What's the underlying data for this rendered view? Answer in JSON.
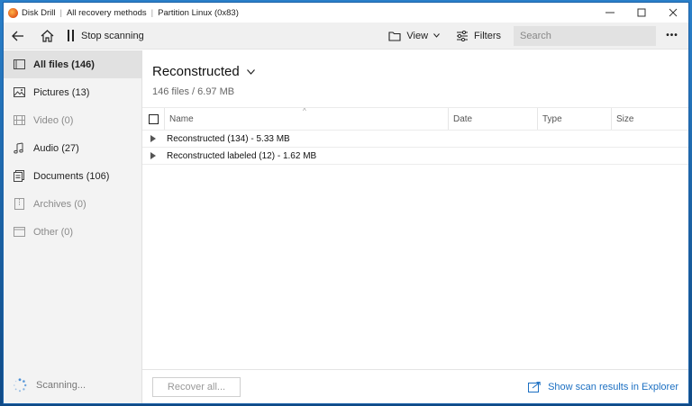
{
  "window": {
    "title_parts": [
      "Disk Drill",
      "All recovery methods",
      "Partition Linux (0x83)"
    ],
    "minimize": "—",
    "maximize": "☐",
    "close": "✕"
  },
  "toolbar": {
    "stop_label": "Stop scanning",
    "view_label": "View",
    "filters_label": "Filters",
    "search_placeholder": "Search",
    "more_label": "•••"
  },
  "sidebar": {
    "items": [
      {
        "label": "All files (146)",
        "icon": "all-files-icon",
        "active": true
      },
      {
        "label": "Pictures (13)",
        "icon": "picture-icon"
      },
      {
        "label": "Video (0)",
        "icon": "video-icon",
        "dim": true
      },
      {
        "label": "Audio (27)",
        "icon": "music-note-icon"
      },
      {
        "label": "Documents (106)",
        "icon": "document-icon"
      },
      {
        "label": "Archives (0)",
        "icon": "archive-icon",
        "dim": true
      },
      {
        "label": "Other (0)",
        "icon": "other-files-icon",
        "dim": true
      }
    ],
    "scan_status": "Scanning..."
  },
  "content": {
    "heading": "Reconstructed",
    "subheading": "146 files / 6.97 MB",
    "columns": [
      "Name",
      "Date",
      "Type",
      "Size"
    ],
    "rows": [
      {
        "label": "Reconstructed (134) - 5.33 MB"
      },
      {
        "label": "Reconstructed labeled (12) - 1.62 MB"
      }
    ]
  },
  "footer": {
    "recover_label": "Recover all...",
    "explorer_label": "Show scan results in Explorer"
  },
  "colors": {
    "accent": "#1b6fc2",
    "sidebar_bg": "#f3f3f3",
    "toolbar_bg": "#f0f0f0"
  }
}
